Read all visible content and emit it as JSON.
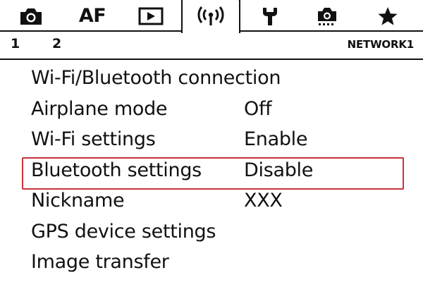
{
  "tabs": [
    {
      "icon": "camera-icon",
      "label": ""
    },
    {
      "icon": "af-text",
      "label": "AF"
    },
    {
      "icon": "playback-icon",
      "label": ""
    },
    {
      "icon": "wireless-icon",
      "label": "",
      "active": true
    },
    {
      "icon": "wrench-icon",
      "label": ""
    },
    {
      "icon": "custom-camera-icon",
      "label": ""
    },
    {
      "icon": "star-icon",
      "label": ""
    }
  ],
  "pages": [
    "1",
    "2"
  ],
  "group_label": "NETWORK1",
  "menu": {
    "items": [
      {
        "label": "Wi-Fi/Bluetooth connection",
        "value": ""
      },
      {
        "label": "Airplane mode",
        "value": "Off"
      },
      {
        "label": "Wi-Fi settings",
        "value": "Enable"
      },
      {
        "label": "Bluetooth settings",
        "value": "Disable",
        "selected": true
      },
      {
        "label": "Nickname",
        "value": "XXX"
      },
      {
        "label": "GPS device settings",
        "value": ""
      },
      {
        "label": "Image transfer",
        "value": ""
      }
    ]
  },
  "colors": {
    "selection_border": "#c8323c",
    "text": "#111111",
    "background": "#ffffff"
  }
}
